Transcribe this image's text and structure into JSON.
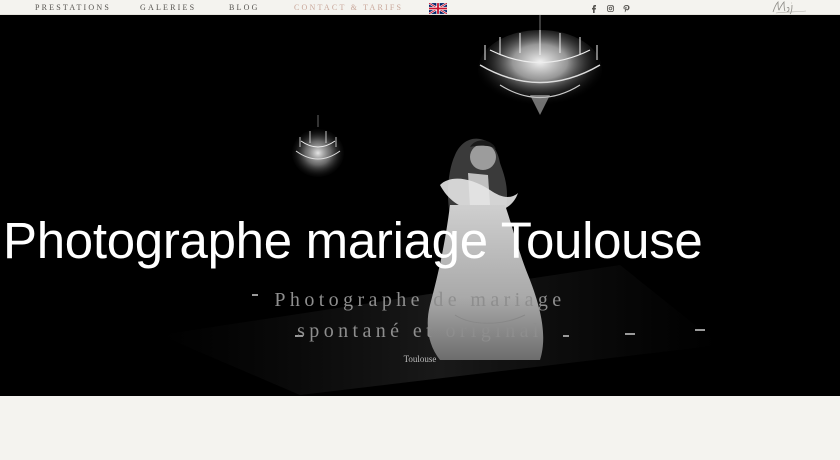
{
  "nav": {
    "items": [
      {
        "label": "PRESTATIONS"
      },
      {
        "label": "GALERIES"
      },
      {
        "label": "BLOG"
      },
      {
        "label": "CONTACT & TARIFS"
      }
    ],
    "active_color": "#c9a79a",
    "language_flag": "uk-flag-icon",
    "social_icons": [
      "facebook-icon",
      "instagram-icon",
      "pinterest-icon"
    ],
    "logo": "signature-logo-icon"
  },
  "hero": {
    "title": "Photographe mariage Toulouse",
    "subtitle_line1": "Photographe de mariage",
    "subtitle_line2": "spontané et original",
    "caption": "Toulouse"
  }
}
